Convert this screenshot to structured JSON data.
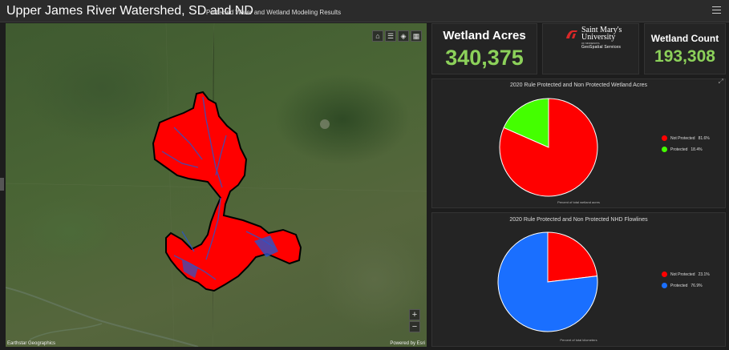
{
  "header": {
    "title": "Upper James River Watershed, SD and ND",
    "subtitle": "Protected Water and Wetland Modeling Results"
  },
  "map": {
    "attribution_left": "Earthstar Geographics",
    "attribution_right": "Powered by Esri",
    "tools": [
      "home-icon",
      "list-icon",
      "layers-icon",
      "grid-icon"
    ],
    "zoom_in": "+",
    "zoom_out": "−"
  },
  "kpi_acres": {
    "label": "Wetland Acres",
    "value": "340,375"
  },
  "kpi_count": {
    "label": "Wetland Count",
    "value": "193,308"
  },
  "logo": {
    "line1": "Saint Mary's",
    "line2": "University",
    "line3": "OF MINNESOTA",
    "line4": "GeoSpatial Services"
  },
  "colors": {
    "accent_green": "#8cd15a",
    "not_protected": "#ff0000",
    "protected_green": "#44ff00",
    "protected_blue": "#1a6fff"
  },
  "chart_data": [
    {
      "type": "pie",
      "title": "2020 Rule Protected and Non Protected Wetland Acres",
      "footnote": "Percent of total wetland acres",
      "slices": [
        {
          "label": "Not Protected",
          "value": 81.6,
          "display": "81.6%",
          "color": "#ff0000"
        },
        {
          "label": "Protected",
          "value": 18.4,
          "display": "18.4%",
          "color": "#44ff00"
        }
      ],
      "legend_position": "right"
    },
    {
      "type": "pie",
      "title": "2020 Rule Protected and Non Protected NHD Flowlines",
      "footnote": "Percent of total kilometers",
      "slices": [
        {
          "label": "Not Protected",
          "value": 23.1,
          "display": "23.1%",
          "color": "#ff0000"
        },
        {
          "label": "Protected",
          "value": 76.9,
          "display": "76.9%",
          "color": "#1a6fff"
        }
      ],
      "legend_position": "right"
    }
  ]
}
